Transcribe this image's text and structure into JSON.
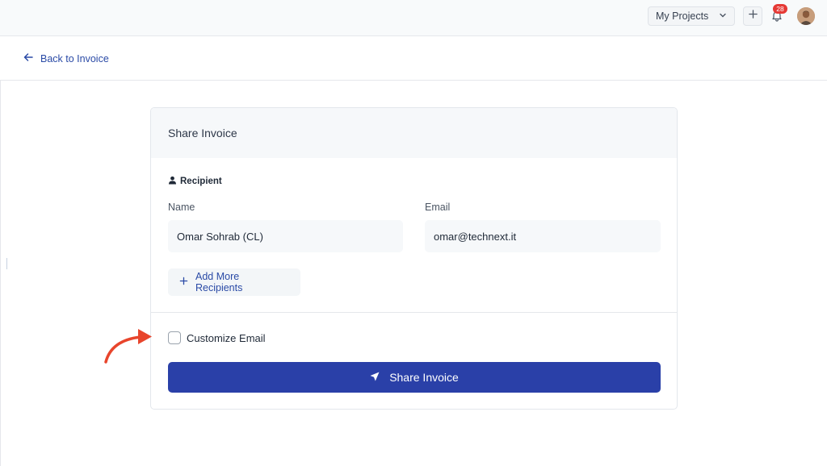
{
  "topbar": {
    "projects_label": "My Projects",
    "notifications_count": "28",
    "icons": [
      "chevron-down-icon",
      "plus-icon",
      "bell-icon",
      "avatar"
    ]
  },
  "nav": {
    "back_label": "Back to Invoice",
    "back_icon": "arrow-left-icon"
  },
  "card": {
    "title": "Share Invoice",
    "recipient_heading": "Recipient",
    "recipient_icon": "user-icon",
    "name_label": "Name",
    "name_value": "Omar Sohrab (CL)",
    "email_label": "Email",
    "email_value": "omar@technext.it",
    "add_more_label": "Add More Recipients",
    "customize_label": "Customize Email",
    "customize_checked": false,
    "share_label": "Share Invoice",
    "share_icon": "send-icon"
  },
  "colors": {
    "accent": "#2a40a8",
    "link": "#2a4aa6",
    "badge": "#e53935",
    "annotation_arrow": "#e8452c"
  }
}
